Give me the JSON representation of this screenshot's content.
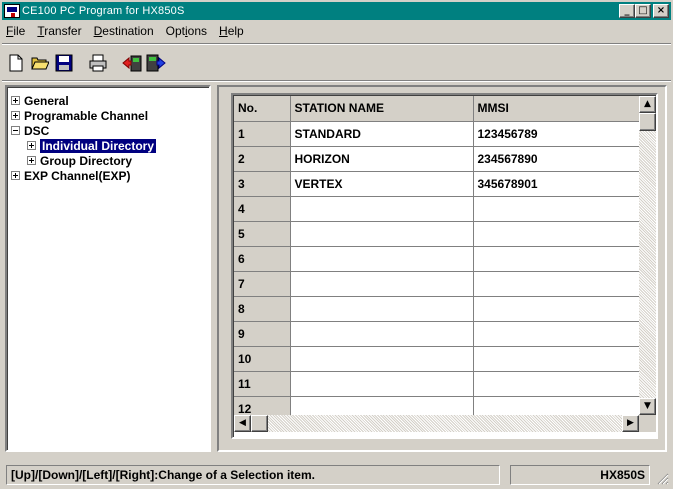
{
  "window": {
    "title": "CE100  PC Program for HX850S",
    "min_label": "_",
    "max_label": "□",
    "close_label": "×"
  },
  "menu": [
    {
      "pre": "",
      "u": "F",
      "post": "ile"
    },
    {
      "pre": "",
      "u": "T",
      "post": "ransfer"
    },
    {
      "pre": "",
      "u": "D",
      "post": "estination"
    },
    {
      "pre": "Opt",
      "u": "i",
      "post": "ons"
    },
    {
      "pre": "",
      "u": "H",
      "post": "elp"
    }
  ],
  "toolbar": {
    "icons": [
      "new-file-icon",
      "open-folder-icon",
      "save-disk-icon",
      "print-icon",
      "read-from-radio-icon",
      "write-to-radio-icon"
    ]
  },
  "tree": {
    "items": [
      {
        "label": "General",
        "expander": "plus",
        "selected": false
      },
      {
        "label": "Programable Channel",
        "expander": "plus",
        "selected": false
      },
      {
        "label": "DSC",
        "expander": "minus",
        "selected": false
      },
      {
        "label": "Individual Directory",
        "expander": "plus",
        "selected": true
      },
      {
        "label": "Group Directory",
        "expander": "plus",
        "selected": false
      },
      {
        "label": "EXP Channel(EXP)",
        "expander": "plus",
        "selected": false
      }
    ]
  },
  "grid": {
    "columns": [
      "No.",
      "STATION NAME",
      "MMSI"
    ],
    "rows": [
      [
        "1",
        "STANDARD",
        "123456789"
      ],
      [
        "2",
        "HORIZON",
        "234567890"
      ],
      [
        "3",
        "VERTEX",
        "345678901"
      ],
      [
        "4",
        "",
        ""
      ],
      [
        "5",
        "",
        ""
      ],
      [
        "6",
        "",
        ""
      ],
      [
        "7",
        "",
        ""
      ],
      [
        "8",
        "",
        ""
      ],
      [
        "9",
        "",
        ""
      ],
      [
        "10",
        "",
        ""
      ],
      [
        "11",
        "",
        ""
      ],
      [
        "12",
        "",
        ""
      ]
    ],
    "scroll_up": "▲",
    "scroll_down": "▼",
    "scroll_left": "◀",
    "scroll_right": "▶"
  },
  "status": {
    "hint": "[Up]/[Down]/[Left]/[Right]:Change of a Selection item.",
    "model": "HX850S"
  },
  "colors": {
    "titlebar": "#008080",
    "selection": "#000080",
    "face": "#d4d0c8"
  }
}
